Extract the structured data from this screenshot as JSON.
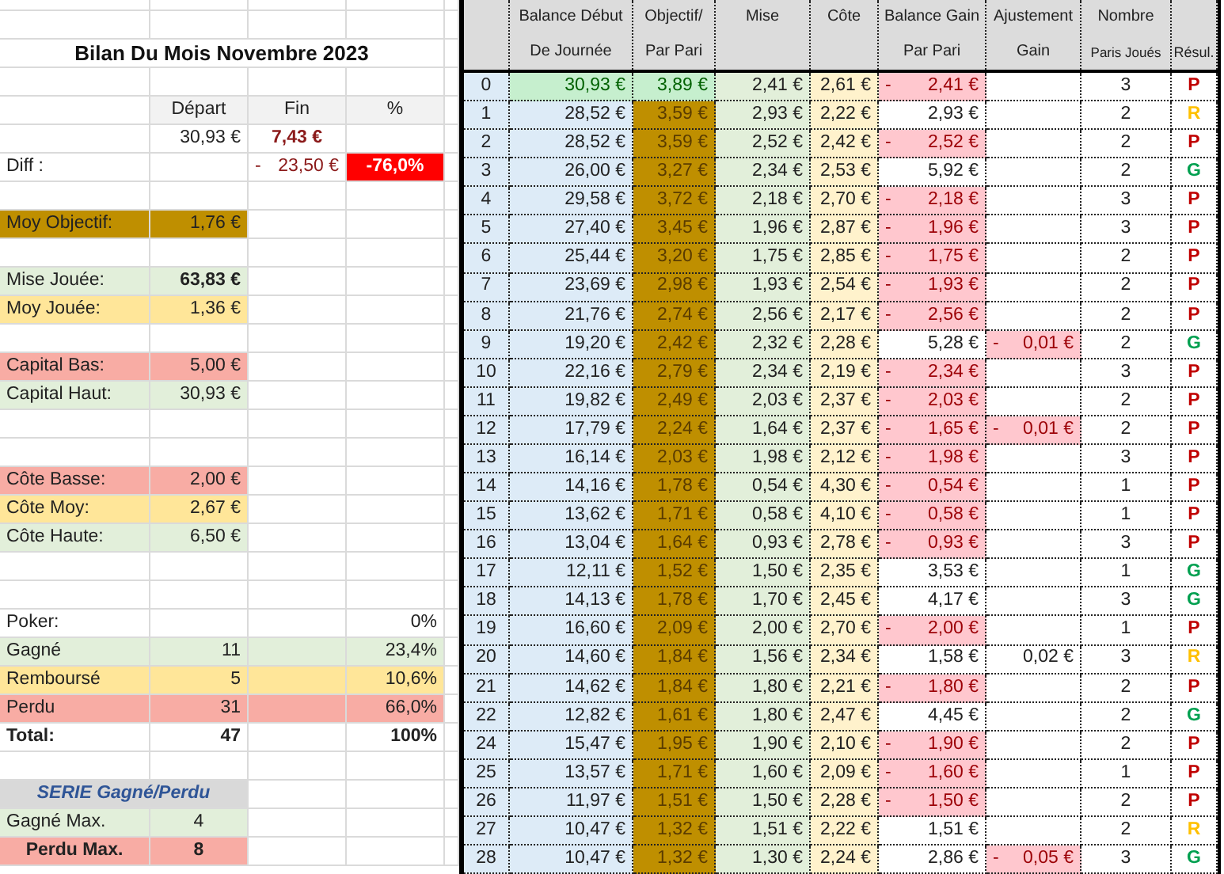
{
  "summary_rows": [
    {
      "kind": "blank"
    },
    {
      "kind": "title",
      "text": "Bilan Du Mois Novembre 2023"
    },
    {
      "kind": "blank"
    },
    {
      "kind": "header",
      "cells": [
        "Départ",
        "Fin",
        "%"
      ]
    },
    {
      "kind": "balance",
      "start": "30,93 €",
      "end": "7,43 €"
    },
    {
      "kind": "diff",
      "label": "Diff :",
      "sign": "-",
      "amount": "23,50 €",
      "percent": "-76,0%"
    },
    {
      "kind": "blank"
    },
    {
      "kind": "stat",
      "label": "Moy Objectif:",
      "value": "1,76 €",
      "color": "#bf8f00"
    },
    {
      "kind": "blank"
    },
    {
      "kind": "stat",
      "label": "Mise Jouée:",
      "value": "63,83 €",
      "color": "#e2efda",
      "bold": true
    },
    {
      "kind": "stat",
      "label": "Moy Jouée:",
      "value": "1,36 €",
      "color": "#ffe699"
    },
    {
      "kind": "blank"
    },
    {
      "kind": "stat",
      "label": "Capital Bas:",
      "value": "5,00 €",
      "color": "#f8aca4"
    },
    {
      "kind": "stat",
      "label": "Capital Haut:",
      "value": "30,93 €",
      "color": "#e2efda"
    },
    {
      "kind": "blank"
    },
    {
      "kind": "blank"
    },
    {
      "kind": "stat",
      "label": "Côte Basse:",
      "value": "2,00 €",
      "color": "#f8aca4"
    },
    {
      "kind": "stat",
      "label": "Côte Moy:",
      "value": "2,67 €",
      "color": "#ffe699"
    },
    {
      "kind": "stat",
      "label": "Côte Haute:",
      "value": "6,50 €",
      "color": "#e2efda"
    },
    {
      "kind": "blank"
    },
    {
      "kind": "blank"
    },
    {
      "kind": "count",
      "label": "Poker:",
      "percent": "0%"
    },
    {
      "kind": "count",
      "label": "Gagné",
      "count": "11",
      "percent": "23,4%",
      "color": "#e2efda"
    },
    {
      "kind": "count",
      "label": "Remboursé",
      "count": "5",
      "percent": "10,6%",
      "color": "#ffe699"
    },
    {
      "kind": "count",
      "label": "Perdu",
      "count": "31",
      "percent": "66,0%",
      "color": "#f8aca4"
    },
    {
      "kind": "total",
      "label": "Total:",
      "count": "47",
      "percent": "100%"
    },
    {
      "kind": "blank"
    },
    {
      "kind": "serie_title",
      "text": "SERIE Gagné/Perdu"
    },
    {
      "kind": "serie",
      "label": "Gagné Max.",
      "value": "4",
      "color": "#e2efda"
    },
    {
      "kind": "serie",
      "label": "Perdu Max.",
      "value": "8",
      "color": "#f8aca4",
      "bold": true
    }
  ],
  "table": {
    "columns": [
      {},
      {
        "top": "Balance Début",
        "bottom": "De Journée"
      },
      {
        "top": "Objectif/",
        "bottom": "Par Pari"
      },
      {
        "top": "Mise"
      },
      {
        "top": "Côte"
      },
      {
        "top": "Balance Gain",
        "bottom": "Par Pari"
      },
      {
        "top": "Ajustement",
        "bottom": "Gain"
      },
      {
        "top": "Nombre",
        "bottom": "Paris Joués"
      },
      {
        "bottom": "Résul."
      }
    ],
    "rows": [
      {
        "kind": "start",
        "day": "0",
        "balance": "30,93 €",
        "goal": "3,89 €",
        "stake": "2,41 €",
        "odds": "2,61 €",
        "gain": {
          "sign": "-",
          "amount": "2,41 €"
        },
        "bets": "3",
        "result": {
          "kind": "lost",
          "letter": "P"
        }
      },
      {
        "kind": "day",
        "day": "1",
        "balance": "28,52 €",
        "goal": "3,59 €",
        "stake": "2,93 €",
        "odds": "2,22 €",
        "gain": {
          "amount": "2,93 €"
        },
        "bets": "2",
        "result": {
          "kind": "refunded",
          "letter": "R"
        }
      },
      {
        "kind": "day",
        "day": "2",
        "balance": "28,52 €",
        "goal": "3,59 €",
        "stake": "2,52 €",
        "odds": "2,42 €",
        "gain": {
          "sign": "-",
          "amount": "2,52 €"
        },
        "bets": "2",
        "result": {
          "kind": "lost",
          "letter": "P"
        }
      },
      {
        "kind": "day",
        "day": "3",
        "balance": "26,00 €",
        "goal": "3,27 €",
        "stake": "2,34 €",
        "odds": "2,53 €",
        "gain": {
          "amount": "5,92 €"
        },
        "bets": "2",
        "result": {
          "kind": "won",
          "letter": "G"
        }
      },
      {
        "kind": "day",
        "day": "4",
        "balance": "29,58 €",
        "goal": "3,72 €",
        "stake": "2,18 €",
        "odds": "2,70 €",
        "gain": {
          "sign": "-",
          "amount": "2,18 €"
        },
        "bets": "3",
        "result": {
          "kind": "lost",
          "letter": "P"
        }
      },
      {
        "kind": "day",
        "day": "5",
        "balance": "27,40 €",
        "goal": "3,45 €",
        "stake": "1,96 €",
        "odds": "2,87 €",
        "gain": {
          "sign": "-",
          "amount": "1,96 €"
        },
        "bets": "3",
        "result": {
          "kind": "lost",
          "letter": "P"
        }
      },
      {
        "kind": "day",
        "day": "6",
        "balance": "25,44 €",
        "goal": "3,20 €",
        "stake": "1,75 €",
        "odds": "2,85 €",
        "gain": {
          "sign": "-",
          "amount": "1,75 €"
        },
        "bets": "2",
        "result": {
          "kind": "lost",
          "letter": "P"
        }
      },
      {
        "kind": "day",
        "day": "7",
        "balance": "23,69 €",
        "goal": "2,98 €",
        "stake": "1,93 €",
        "odds": "2,54 €",
        "gain": {
          "sign": "-",
          "amount": "1,93 €"
        },
        "bets": "2",
        "result": {
          "kind": "lost",
          "letter": "P"
        }
      },
      {
        "kind": "day",
        "day": "8",
        "balance": "21,76 €",
        "goal": "2,74 €",
        "stake": "2,56 €",
        "odds": "2,17 €",
        "gain": {
          "sign": "-",
          "amount": "2,56 €"
        },
        "bets": "2",
        "result": {
          "kind": "lost",
          "letter": "P"
        }
      },
      {
        "kind": "day",
        "day": "9",
        "balance": "19,20 €",
        "goal": "2,42 €",
        "stake": "2,32 €",
        "odds": "2,28 €",
        "gain": {
          "amount": "5,28 €"
        },
        "adjustment": {
          "sign": "-",
          "amount": "0,01 €"
        },
        "bets": "2",
        "result": {
          "kind": "won",
          "letter": "G"
        }
      },
      {
        "kind": "day",
        "day": "10",
        "balance": "22,16 €",
        "goal": "2,79 €",
        "stake": "2,34 €",
        "odds": "2,19 €",
        "gain": {
          "sign": "-",
          "amount": "2,34 €"
        },
        "bets": "3",
        "result": {
          "kind": "lost",
          "letter": "P"
        }
      },
      {
        "kind": "day",
        "day": "11",
        "balance": "19,82 €",
        "goal": "2,49 €",
        "stake": "2,03 €",
        "odds": "2,37 €",
        "gain": {
          "sign": "-",
          "amount": "2,03 €"
        },
        "bets": "2",
        "result": {
          "kind": "lost",
          "letter": "P"
        }
      },
      {
        "kind": "day",
        "day": "12",
        "balance": "17,79 €",
        "goal": "2,24 €",
        "stake": "1,64 €",
        "odds": "2,37 €",
        "gain": {
          "sign": "-",
          "amount": "1,65 €"
        },
        "adjustment": {
          "sign": "-",
          "amount": "0,01 €"
        },
        "bets": "2",
        "result": {
          "kind": "lost",
          "letter": "P"
        }
      },
      {
        "kind": "day",
        "day": "13",
        "balance": "16,14 €",
        "goal": "2,03 €",
        "stake": "1,98 €",
        "odds": "2,12 €",
        "gain": {
          "sign": "-",
          "amount": "1,98 €"
        },
        "bets": "3",
        "result": {
          "kind": "lost",
          "letter": "P"
        }
      },
      {
        "kind": "day",
        "day": "14",
        "balance": "14,16 €",
        "goal": "1,78 €",
        "stake": "0,54 €",
        "odds": "4,30 €",
        "gain": {
          "sign": "-",
          "amount": "0,54 €"
        },
        "bets": "1",
        "result": {
          "kind": "lost",
          "letter": "P"
        }
      },
      {
        "kind": "day",
        "day": "15",
        "balance": "13,62 €",
        "goal": "1,71 €",
        "stake": "0,58 €",
        "odds": "4,10 €",
        "gain": {
          "sign": "-",
          "amount": "0,58 €"
        },
        "bets": "1",
        "result": {
          "kind": "lost",
          "letter": "P"
        }
      },
      {
        "kind": "day",
        "day": "16",
        "balance": "13,04 €",
        "goal": "1,64 €",
        "stake": "0,93 €",
        "odds": "2,78 €",
        "gain": {
          "sign": "-",
          "amount": "0,93 €"
        },
        "bets": "3",
        "result": {
          "kind": "lost",
          "letter": "P"
        }
      },
      {
        "kind": "day",
        "day": "17",
        "balance": "12,11 €",
        "goal": "1,52 €",
        "stake": "1,50 €",
        "odds": "2,35 €",
        "gain": {
          "amount": "3,53 €"
        },
        "bets": "1",
        "result": {
          "kind": "won",
          "letter": "G"
        }
      },
      {
        "kind": "day",
        "day": "18",
        "balance": "14,13 €",
        "goal": "1,78 €",
        "stake": "1,70 €",
        "odds": "2,45 €",
        "gain": {
          "amount": "4,17 €"
        },
        "bets": "3",
        "result": {
          "kind": "won",
          "letter": "G"
        }
      },
      {
        "kind": "day",
        "day": "19",
        "balance": "16,60 €",
        "goal": "2,09 €",
        "stake": "2,00 €",
        "odds": "2,70 €",
        "gain": {
          "sign": "-",
          "amount": "2,00 €"
        },
        "bets": "1",
        "result": {
          "kind": "lost",
          "letter": "P"
        }
      },
      {
        "kind": "day",
        "day": "20",
        "balance": "14,60 €",
        "goal": "1,84 €",
        "stake": "1,56 €",
        "odds": "2,34 €",
        "gain": {
          "amount": "1,58 €"
        },
        "adjustment": {
          "amount": "0,02 €"
        },
        "bets": "3",
        "result": {
          "kind": "refunded",
          "letter": "R"
        }
      },
      {
        "kind": "day",
        "day": "21",
        "balance": "14,62 €",
        "goal": "1,84 €",
        "stake": "1,80 €",
        "odds": "2,21 €",
        "gain": {
          "sign": "-",
          "amount": "1,80 €"
        },
        "bets": "2",
        "result": {
          "kind": "lost",
          "letter": "P"
        }
      },
      {
        "kind": "day",
        "day": "22",
        "balance": "12,82 €",
        "goal": "1,61 €",
        "stake": "1,80 €",
        "odds": "2,47 €",
        "gain": {
          "amount": "4,45 €"
        },
        "bets": "2",
        "result": {
          "kind": "won",
          "letter": "G"
        }
      },
      {
        "kind": "day",
        "day": "24",
        "balance": "15,47 €",
        "goal": "1,95 €",
        "stake": "1,90 €",
        "odds": "2,10 €",
        "gain": {
          "sign": "-",
          "amount": "1,90 €"
        },
        "bets": "2",
        "result": {
          "kind": "lost",
          "letter": "P"
        }
      },
      {
        "kind": "day",
        "day": "25",
        "balance": "13,57 €",
        "goal": "1,71 €",
        "stake": "1,60 €",
        "odds": "2,09 €",
        "gain": {
          "sign": "-",
          "amount": "1,60 €"
        },
        "bets": "1",
        "result": {
          "kind": "lost",
          "letter": "P"
        }
      },
      {
        "kind": "day",
        "day": "26",
        "balance": "11,97 €",
        "goal": "1,51 €",
        "stake": "1,50 €",
        "odds": "2,28 €",
        "gain": {
          "sign": "-",
          "amount": "1,50 €"
        },
        "bets": "2",
        "result": {
          "kind": "lost",
          "letter": "P"
        }
      },
      {
        "kind": "day",
        "day": "27",
        "balance": "10,47 €",
        "goal": "1,32 €",
        "stake": "1,51 €",
        "odds": "2,22 €",
        "gain": {
          "amount": "1,51 €"
        },
        "bets": "2",
        "result": {
          "kind": "refunded",
          "letter": "R"
        }
      },
      {
        "kind": "day",
        "day": "28",
        "balance": "10,47 €",
        "goal": "1,32 €",
        "stake": "1,30 €",
        "odds": "2,24 €",
        "gain": {
          "amount": "2,86 €"
        },
        "adjustment": {
          "sign": "-",
          "amount": "0,05 €"
        },
        "bets": "3",
        "result": {
          "kind": "won",
          "letter": "G"
        }
      }
    ]
  }
}
